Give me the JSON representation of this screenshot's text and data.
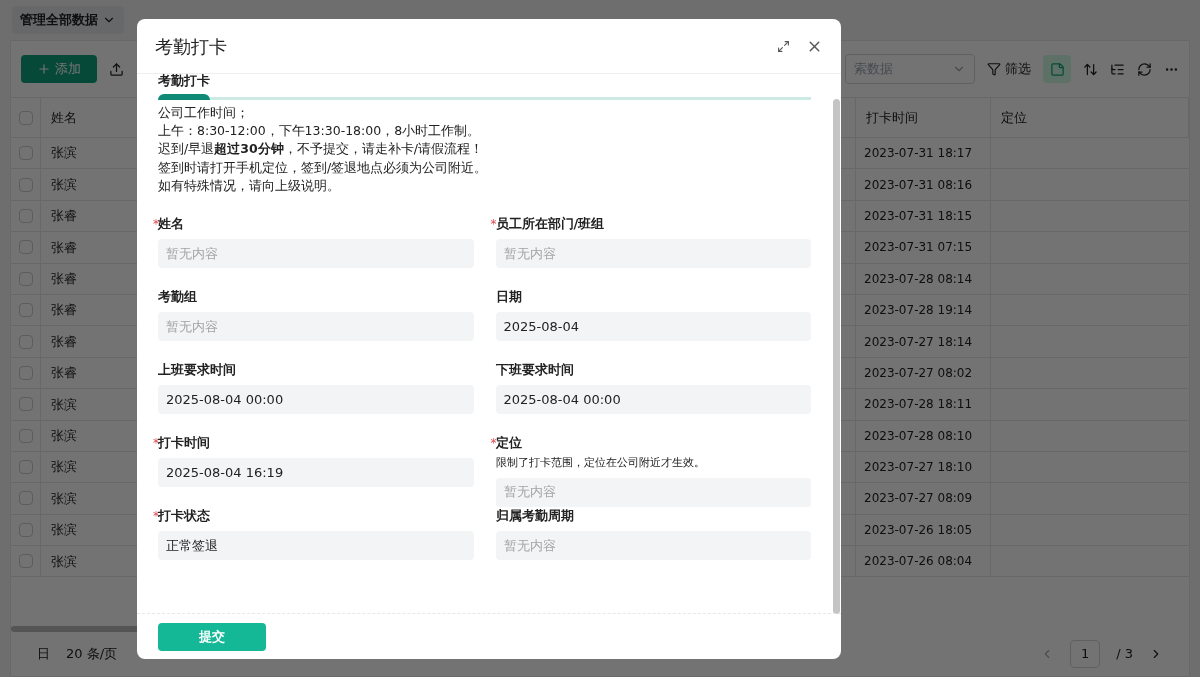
{
  "page": {
    "scope_dropdown": "管理全部数据",
    "add_button": "添加",
    "search": {
      "placeholder": "索数据"
    },
    "filter_button": "筛选",
    "table": {
      "columns": [
        "姓名",
        "打卡时间",
        "定位"
      ],
      "all_checked": false,
      "rows": [
        {
          "name": "张滨",
          "time": "2023-07-31 18:17",
          "checked": false
        },
        {
          "name": "张滨",
          "time": "2023-07-31 08:16",
          "checked": false
        },
        {
          "name": "张睿",
          "time": "2023-07-31 18:15",
          "checked": false
        },
        {
          "name": "张睿",
          "time": "2023-07-31 07:15",
          "checked": false
        },
        {
          "name": "张睿",
          "time": "2023-07-28 08:14",
          "checked": false
        },
        {
          "name": "张睿",
          "time": "2023-07-28 19:14",
          "checked": false
        },
        {
          "name": "张睿",
          "time": "2023-07-27 18:14",
          "checked": false
        },
        {
          "name": "张睿",
          "time": "2023-07-27 08:02",
          "checked": false
        },
        {
          "name": "张滨",
          "time": "2023-07-28 18:11",
          "checked": false
        },
        {
          "name": "张滨",
          "time": "2023-07-28 08:10",
          "checked": false
        },
        {
          "name": "张滨",
          "time": "2023-07-27 18:10",
          "checked": false
        },
        {
          "name": "张滨",
          "time": "2023-07-27 08:09",
          "checked": false
        },
        {
          "name": "张滨",
          "time": "2023-07-26 18:05",
          "checked": false
        },
        {
          "name": "张滨",
          "time": "2023-07-26 08:04",
          "checked": false
        }
      ]
    },
    "footer": {
      "label": "日",
      "page_size": "20 条/页",
      "page": "1",
      "pages": "/ 3"
    }
  },
  "dialog": {
    "title": "考勤打卡",
    "section_title": "考勤打卡",
    "required_mark": "*",
    "notice": [
      "公司工作时间；",
      "上午：8:30-12:00，下午13:30-18:00，8小时工作制。",
      "迟到/早退**超过30分钟**，不予提交，请走补卡/请假流程！",
      "签到时请打开手机定位，签到/签退地点必须为公司附近。",
      "如有特殊情况，请向上级说明。"
    ],
    "fields": [
      {
        "label": "姓名",
        "required": true,
        "placeholder": "暂无内容"
      },
      {
        "label": "员工所在部门/班组",
        "required": true,
        "placeholder": "暂无内容"
      },
      {
        "label": "考勤组",
        "required": false,
        "placeholder": "暂无内容"
      },
      {
        "label": "日期",
        "required": false,
        "value": "2025-08-04"
      },
      {
        "label": "上班要求时间",
        "required": false,
        "value": "2025-08-04 00:00"
      },
      {
        "label": "下班要求时间",
        "required": false,
        "value": "2025-08-04 00:00"
      },
      {
        "label": "打卡时间",
        "required": true,
        "value": "2025-08-04 16:19"
      },
      {
        "label": "定位",
        "required": true,
        "hint": "限制了打卡范围，定位在公司附近才生效。",
        "placeholder": "暂无内容"
      },
      {
        "label": "打卡状态",
        "required": true,
        "value": "正常签退"
      },
      {
        "label": "归属考勤周期",
        "required": false,
        "placeholder": "暂无内容"
      }
    ],
    "submit_button": "提交"
  }
}
